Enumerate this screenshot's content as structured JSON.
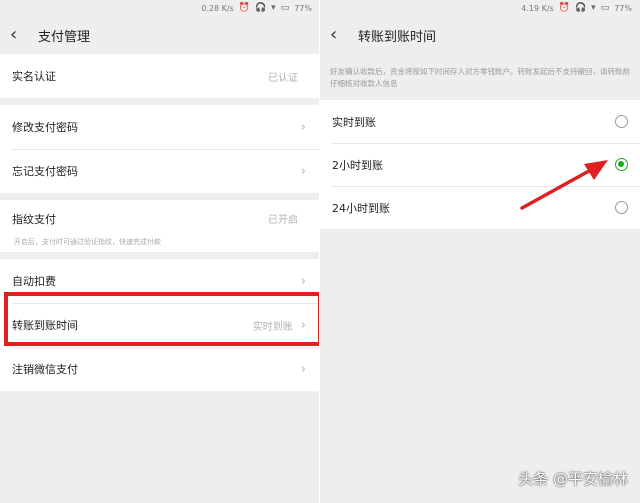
{
  "left": {
    "status": {
      "speed": "0.28 K/s",
      "battery": "77%"
    },
    "title": "支付管理",
    "items": {
      "realname": {
        "label": "实名认证",
        "value": "已认证"
      },
      "change_pwd": {
        "label": "修改支付密码"
      },
      "forgot_pwd": {
        "label": "忘记支付密码"
      },
      "fingerprint": {
        "label": "指纹支付",
        "value": "已开启",
        "hint": "开启后，支付时可通过验证指纹，快速完成付款"
      },
      "auto_deduct": {
        "label": "自动扣费"
      },
      "transfer_time": {
        "label": "转账到账时间",
        "value": "实时到账"
      },
      "cancel": {
        "label": "注销微信支付"
      }
    }
  },
  "right": {
    "status": {
      "speed": "4.19 K/s",
      "battery": "77%"
    },
    "title": "转账到账时间",
    "notice": "好友确认收款后，资金将按如下时间存入对方零钱账户。转账发起后不支持撤回，请转账前仔细核对收款人信息",
    "options": [
      {
        "label": "实时到账",
        "checked": false
      },
      {
        "label": "2小时到账",
        "checked": true
      },
      {
        "label": "24小时到账",
        "checked": false
      }
    ]
  },
  "colors": {
    "accent": "#1aad19",
    "highlight": "#e02020"
  },
  "watermark": "头条 @平安榆林"
}
